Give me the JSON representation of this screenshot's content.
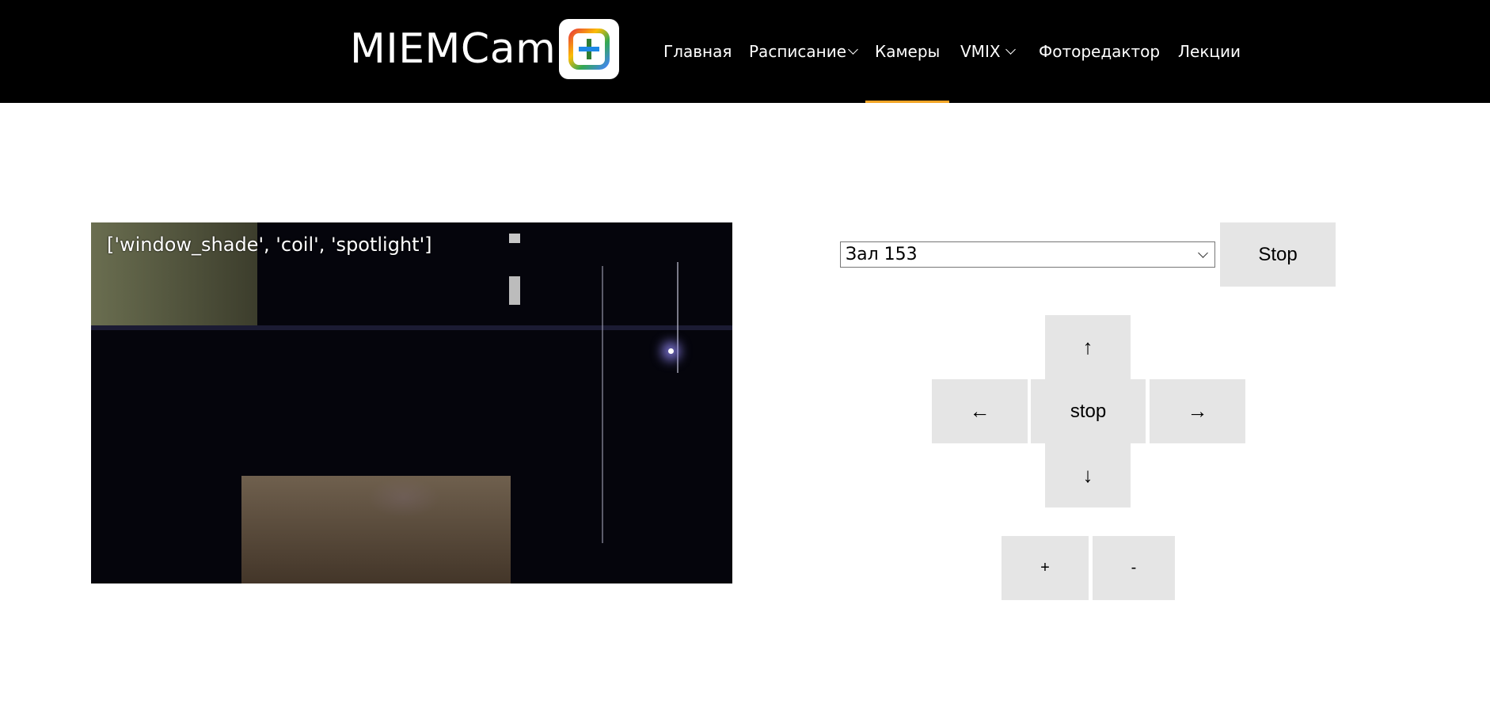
{
  "header": {
    "brand": "MIEMCam",
    "logo_icon": "plus-logo-icon",
    "nav": [
      {
        "label": "Главная",
        "dropdown": false,
        "active": false
      },
      {
        "label": "Расписание",
        "dropdown": true,
        "active": false
      },
      {
        "label": "Камеры",
        "dropdown": false,
        "active": true
      },
      {
        "label": "VMIX",
        "dropdown": true,
        "active": false
      },
      {
        "label": "Фоторедактор",
        "dropdown": false,
        "active": false
      },
      {
        "label": "Лекции",
        "dropdown": false,
        "active": false
      }
    ],
    "active_color": "#f2a526"
  },
  "video": {
    "overlay_text": "['window_shade', 'coil', 'spotlight']"
  },
  "controls": {
    "camera_select": "Зал 153",
    "stop_main": "Stop",
    "up": "↑",
    "left": "←",
    "stop": "stop",
    "right": "→",
    "down": "↓",
    "zoom_in": "+",
    "zoom_out": "-"
  }
}
